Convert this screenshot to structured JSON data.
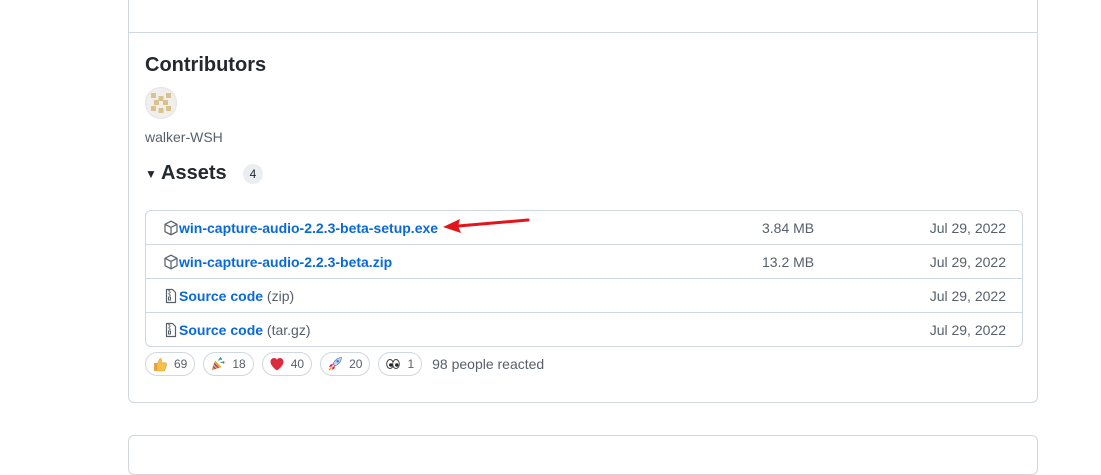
{
  "contributors": {
    "title": "Contributors",
    "users": [
      {
        "name": "walker-WSH"
      }
    ]
  },
  "assets": {
    "title": "Assets",
    "count": "4",
    "items": [
      {
        "name": "win-capture-audio-2.2.3-beta-setup.exe",
        "suffix": "",
        "size": "3.84 MB",
        "date": "Jul 29, 2022",
        "icon": "package-icon"
      },
      {
        "name": "win-capture-audio-2.2.3-beta.zip",
        "suffix": "",
        "size": "13.2 MB",
        "date": "Jul 29, 2022",
        "icon": "package-icon"
      },
      {
        "name": "Source code",
        "suffix": "(zip)",
        "size": "",
        "date": "Jul 29, 2022",
        "icon": "file-zip-icon"
      },
      {
        "name": "Source code",
        "suffix": "(tar.gz)",
        "size": "",
        "date": "Jul 29, 2022",
        "icon": "file-zip-icon"
      }
    ]
  },
  "reactions": {
    "items": [
      {
        "emoji": "thumbs-up-icon",
        "count": "69"
      },
      {
        "emoji": "party-popper-icon",
        "count": "18"
      },
      {
        "emoji": "heart-icon",
        "count": "40"
      },
      {
        "emoji": "rocket-icon",
        "count": "20"
      },
      {
        "emoji": "eyes-icon",
        "count": "1"
      }
    ],
    "summary": "98 people reacted"
  },
  "annotation": {
    "color": "#e3141c",
    "icon": "red-arrow-annotation"
  },
  "colors": {
    "link": "#0969da",
    "muted": "#57606a",
    "border": "#d0d7de"
  }
}
